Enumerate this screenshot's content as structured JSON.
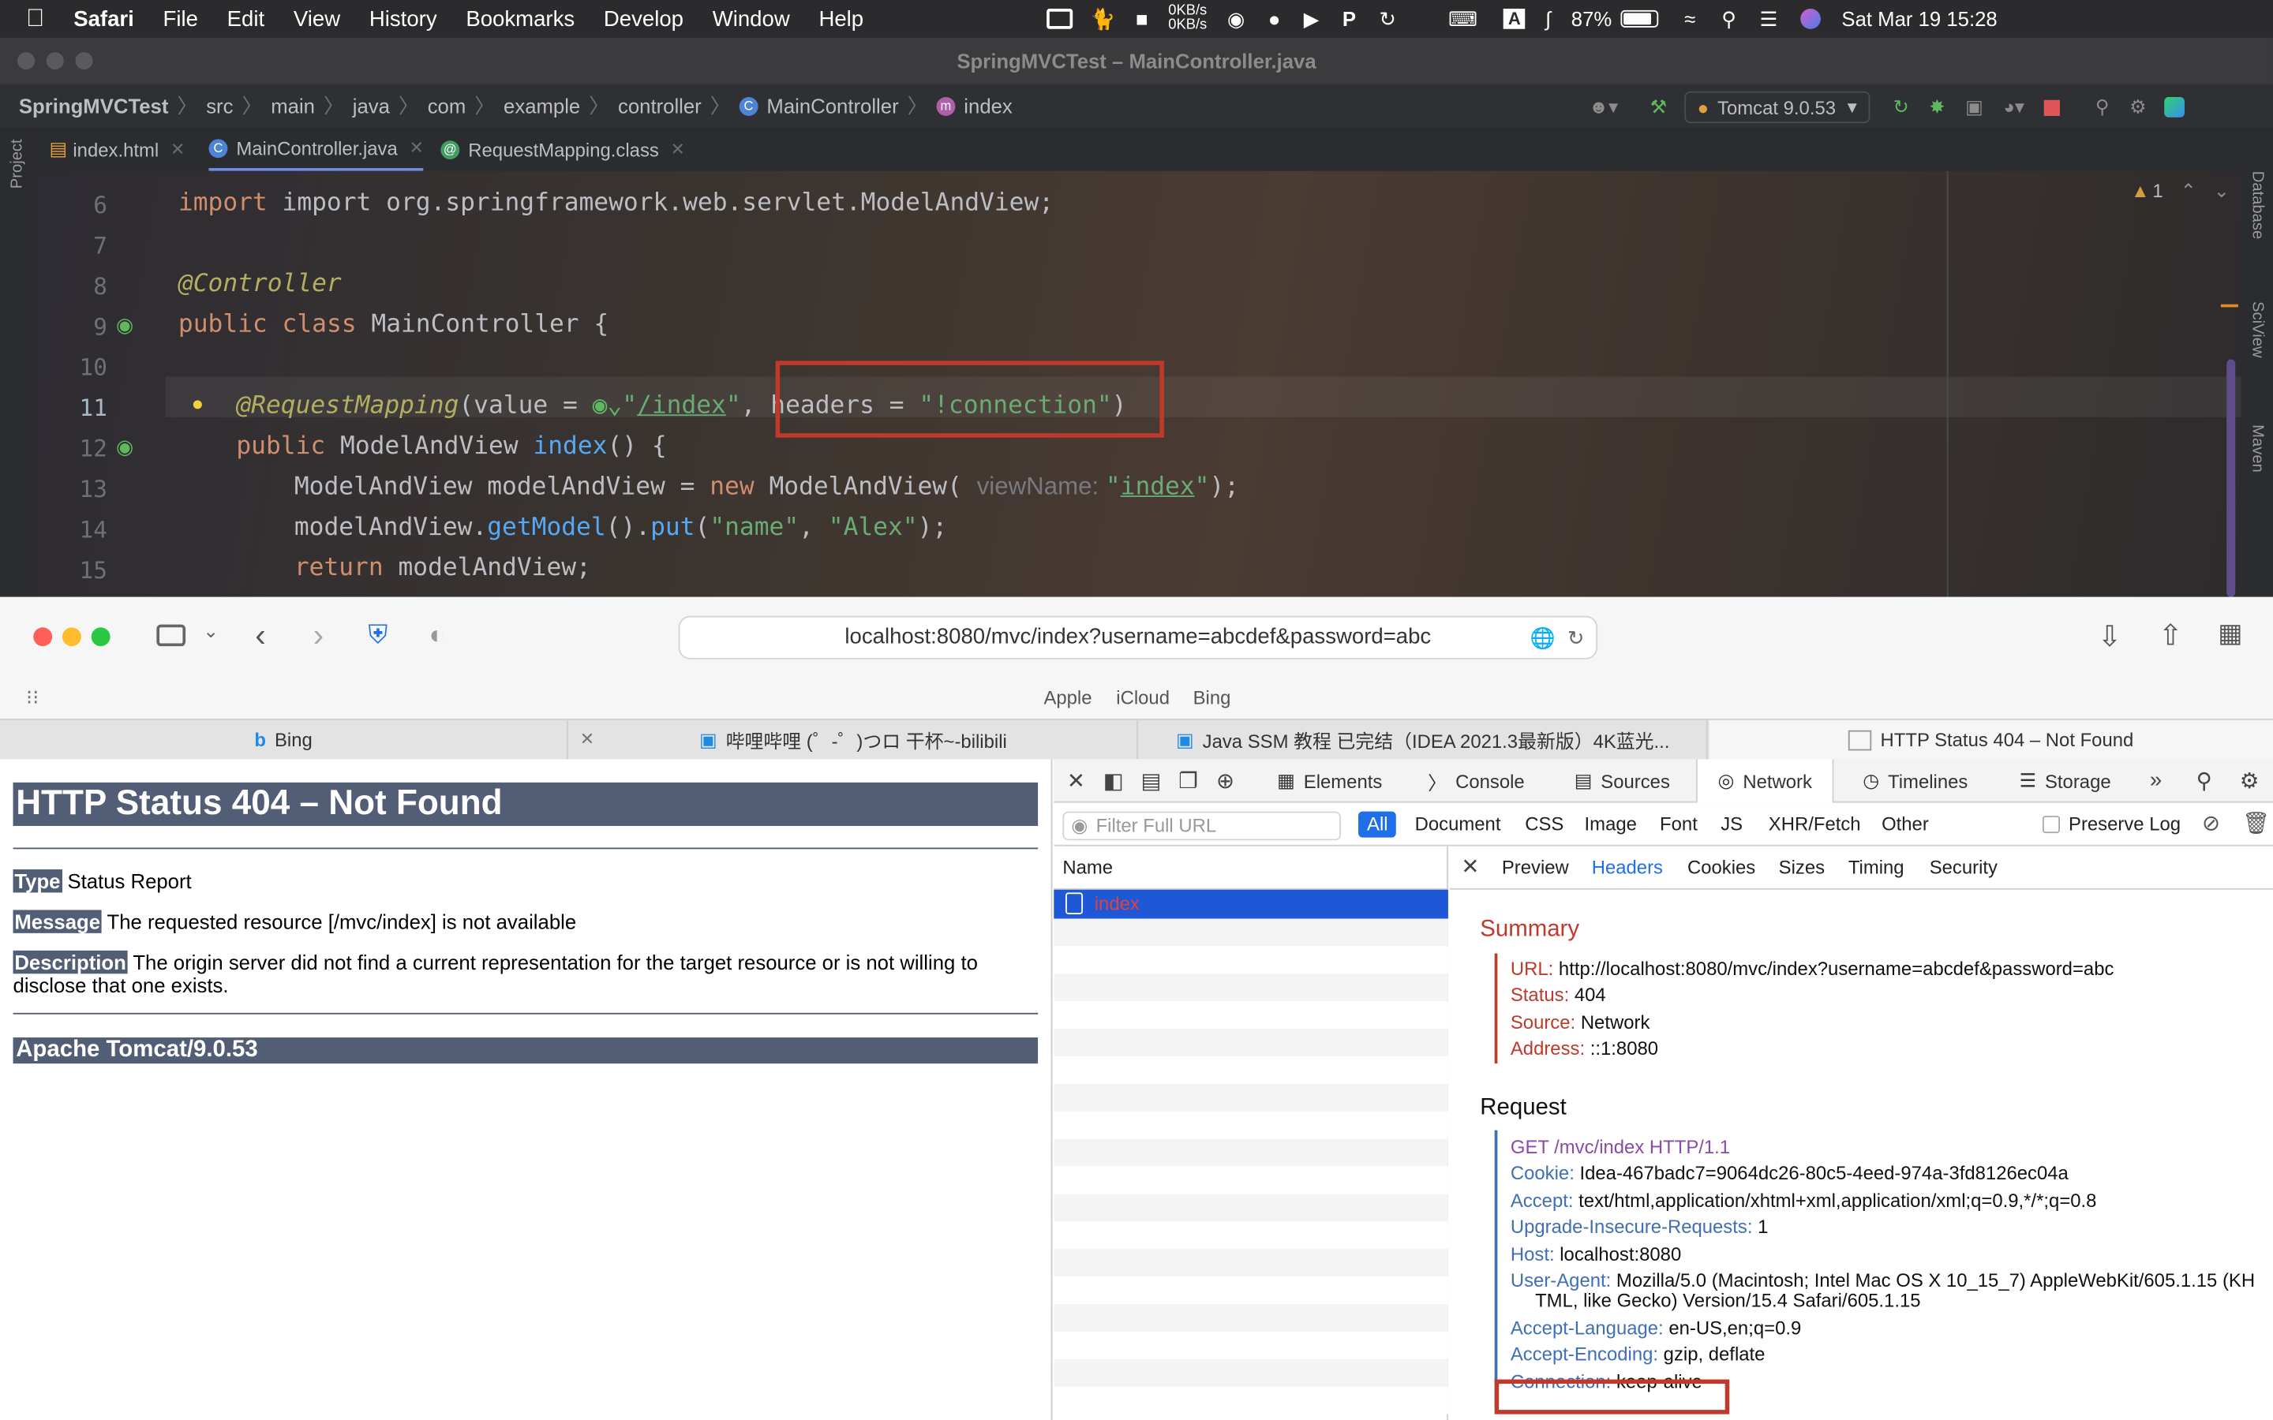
{
  "menubar": {
    "app": "Safari",
    "items": [
      "File",
      "Edit",
      "View",
      "History",
      "Bookmarks",
      "Develop",
      "Window",
      "Help"
    ],
    "net_up": "0KB/s",
    "net_down": "0KB/s",
    "battery": "87%",
    "datetime": "Sat Mar 19  15:28"
  },
  "ide": {
    "window_title": "SpringMVCTest – MainController.java",
    "breadcrumb": [
      "SpringMVCTest",
      "src",
      "main",
      "java",
      "com",
      "example",
      "controller",
      "MainController",
      "index"
    ],
    "run_config": "Tomcat 9.0.53",
    "tabs": [
      "index.html",
      "MainController.java",
      "RequestMapping.class"
    ],
    "warnings": "1",
    "side_left": "Project",
    "side_right": [
      "Database",
      "SciView",
      "Maven"
    ],
    "lines": {
      "l6": {
        "num": "6",
        "text": "import org.springframework.web.servlet.ModelAndView;"
      },
      "l7": {
        "num": "7"
      },
      "l8": {
        "num": "8",
        "ann": "@Controller"
      },
      "l9": {
        "num": "9",
        "kw1": "public",
        "kw2": "class",
        "name": "MainController",
        "brace": "{"
      },
      "l10": {
        "num": "10"
      },
      "l11": {
        "num": "11",
        "ann": "@RequestMapping",
        "p1": "(value = ",
        "q1": "\"",
        "path": "/index",
        "q2": "\"",
        "comma": ", ",
        "headers": "headers = ",
        "hval": "\"!connection\"",
        "close": ")"
      },
      "l12": {
        "num": "12",
        "kw": "public",
        "type": "ModelAndView",
        "fn": "index",
        "rest": "() {"
      },
      "l13": {
        "num": "13",
        "type1": "ModelAndView",
        "var": " modelAndView = ",
        "kw": "new",
        "type2": " ModelAndView",
        "p1": "( ",
        "hint": "viewName: ",
        "q1": "\"",
        "arg": "index",
        "q2": "\"",
        "end": ");"
      },
      "l14": {
        "num": "14",
        "obj": "modelAndView.",
        "m1": "getModel",
        "m1p": "().",
        "m2": "put",
        "m2a": "(",
        "a1": "\"name\"",
        "sep": ", ",
        "a2": "\"Alex\"",
        "end": ");"
      },
      "l15": {
        "num": "15",
        "kw": "return",
        "rest": " modelAndView;"
      }
    }
  },
  "safari": {
    "url": "localhost:8080/mvc/index?username=abcdef&password=abc",
    "favorites": [
      "Apple",
      "iCloud",
      "Bing"
    ],
    "tabs": [
      "Bing",
      "哔哩哔哩 (゜-゜)つロ 干杯~-bilibili",
      "Java SSM 教程 已完结（IDEA 2021.3最新版）4K蓝光...",
      "HTTP Status 404 – Not Found"
    ]
  },
  "page": {
    "h1": "HTTP Status 404 – Not Found",
    "type_label": "Type",
    "type_value": " Status Report",
    "message_label": "Message",
    "message_value": " The requested resource [/mvc/index] is not available",
    "description_label": "Description",
    "description_value": " The origin server did not find a current representation for the target resource or is not willing to disclose that one exists.",
    "footer": "Apache Tomcat/9.0.53"
  },
  "devtools": {
    "tabs": [
      "Elements",
      "Console",
      "Sources",
      "Network",
      "Timelines",
      "Storage"
    ],
    "filter_placeholder": "Filter Full URL",
    "types": [
      "All",
      "Document",
      "CSS",
      "Image",
      "Font",
      "JS",
      "XHR/Fetch",
      "Other"
    ],
    "preserve_log": "Preserve Log",
    "list_header": "Name",
    "request_name": "index",
    "detail_tabs": [
      "Preview",
      "Headers",
      "Cookies",
      "Sizes",
      "Timing",
      "Security"
    ],
    "summary_title": "Summary",
    "summary": [
      {
        "k": "URL:",
        "v": " http://localhost:8080/mvc/index?username=abcdef&password=abc"
      },
      {
        "k": "Status:",
        "v": " 404"
      },
      {
        "k": "Source:",
        "v": " Network"
      },
      {
        "k": "Address:",
        "v": " ::1:8080"
      }
    ],
    "request_title": "Request",
    "request_line": "GET /mvc/index HTTP/1.1",
    "headers": [
      {
        "k": "Cookie:",
        "v": " Idea-467badc7=9064dc26-80c5-4eed-974a-3fd8126ec04a"
      },
      {
        "k": "Accept:",
        "v": " text/html,application/xhtml+xml,application/xml;q=0.9,*/*;q=0.8"
      },
      {
        "k": "Upgrade-Insecure-Requests:",
        "v": " 1"
      },
      {
        "k": "Host:",
        "v": " localhost:8080"
      },
      {
        "k": "User-Agent:",
        "v": " Mozilla/5.0 (Macintosh; Intel Mac OS X 10_15_7) AppleWebKit/605.1.15 (KH"
      },
      {
        "k": "",
        "v": "TML, like Gecko) Version/15.4 Safari/605.1.15"
      },
      {
        "k": "Accept-Language:",
        "v": " en-US,en;q=0.9"
      },
      {
        "k": "Accept-Encoding:",
        "v": " gzip, deflate"
      },
      {
        "k": "Connection:",
        "v": " keep-alive"
      }
    ]
  }
}
